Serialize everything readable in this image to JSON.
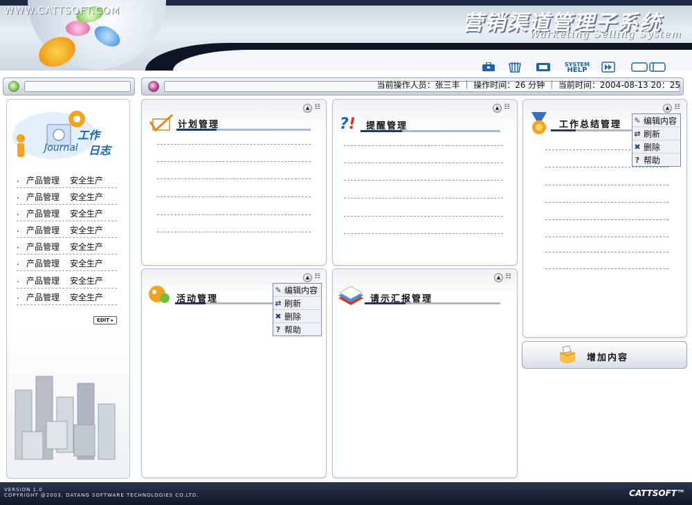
{
  "header": {
    "site_url": "WWW.CATTSOFT.COM",
    "system_title": "营销渠道管理子系统",
    "system_subtitle": "Warketing Selling System",
    "toolbar_icons": [
      "briefcase-icon",
      "calendar-icon",
      "monitor-icon",
      "system-help-icon",
      "forward-icon",
      "window-toggle-icon"
    ],
    "help_label_top": "SYSTEM",
    "help_label_bottom": "HELP"
  },
  "sidebar": {
    "logo_title": "工作",
    "logo_en": "Journal",
    "logo_cn": "日志",
    "items": [
      {
        "bullet": ".",
        "label": "产品管理",
        "label2": "安全生产"
      },
      {
        "bullet": ".",
        "label": "产品管理",
        "label2": "安全生产"
      },
      {
        "bullet": ".",
        "label": "产品管理",
        "label2": "安全生产"
      },
      {
        "bullet": ".",
        "label": "产品管理",
        "label2": "安全生产"
      },
      {
        "bullet": ".",
        "label": "产品管理",
        "label2": "安全生产"
      },
      {
        "bullet": ".",
        "label": "产品管理",
        "label2": "安全生产"
      },
      {
        "bullet": ".",
        "label": "产品管理",
        "label2": "安全生产"
      },
      {
        "bullet": ".",
        "label": "产品管理",
        "label2": "安全生产"
      }
    ],
    "edit_label": "EDIT"
  },
  "status": {
    "text": "当前操作人员：张三丰 ｜ 操作时间：26 分钟 ｜ 当前时间：2004-08-13 20：25"
  },
  "panels": {
    "plan": {
      "title": "计划管理"
    },
    "reminder": {
      "title": "提醒管理"
    },
    "summary": {
      "title": "工作总结管理"
    },
    "activity": {
      "title": "活动管理"
    },
    "report": {
      "title": "请示汇报管理"
    }
  },
  "context_menu": {
    "items": [
      {
        "icon": "pencil-icon",
        "label": "编辑内容"
      },
      {
        "icon": "refresh-icon",
        "label": "刷新"
      },
      {
        "icon": "delete-icon",
        "label": "删除"
      },
      {
        "icon": "help-icon",
        "label": "帮助"
      }
    ]
  },
  "add_content": {
    "label": "增加内容"
  },
  "footer": {
    "version": "VERSION 1.0",
    "copyright": "COPYRIGHT @2003. DATANG SOFTWARE TECHNOLOGIES CO.LTD.",
    "brand": "CATTSOFT™"
  },
  "colors": {
    "accent": "#1b62b3",
    "title_line_dark": "#1f3a66",
    "footer_bg": "#101828"
  }
}
